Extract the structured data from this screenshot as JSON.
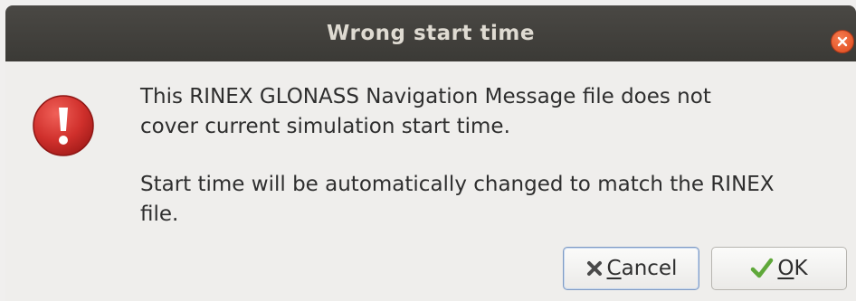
{
  "window": {
    "title": "Wrong start time"
  },
  "icons": {
    "close": "close-icon",
    "error": "error-icon",
    "cancel": "x-icon",
    "ok": "checkmark-icon"
  },
  "colors": {
    "titlebar": "#3f3e3a",
    "close_button": "#e8562a",
    "error_icon": "#d0302c",
    "focus_border": "#7f9bc4"
  },
  "message": {
    "line1": "This RINEX GLONASS Navigation Message file does not",
    "line2": "cover current simulation start time.",
    "line3": "Start time will be automatically changed to match the RINEX",
    "line4": "file."
  },
  "buttons": {
    "cancel": {
      "mnemonic": "C",
      "rest": "ancel"
    },
    "ok": {
      "mnemonic": "O",
      "rest": "K"
    }
  }
}
